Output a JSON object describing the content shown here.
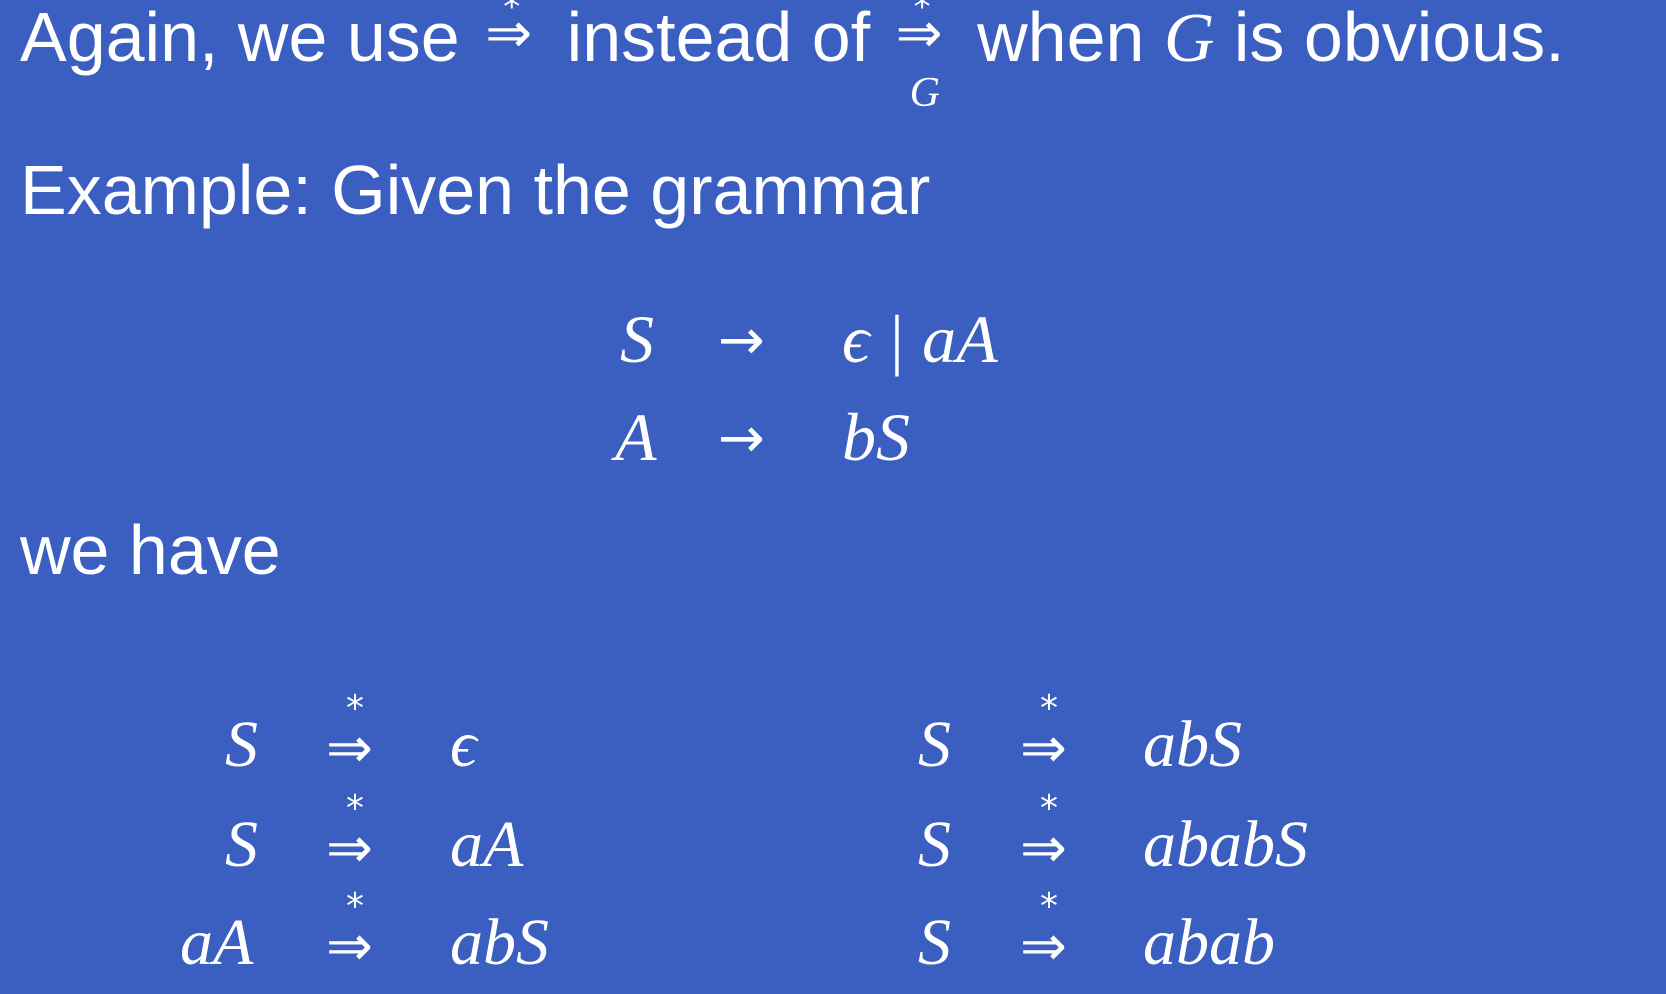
{
  "intro": {
    "part1": "Again, we use",
    "part2": "instead of",
    "part3": "when",
    "grammar_var": "G",
    "part4": "is obvious."
  },
  "symbols": {
    "derives_star": "⇒",
    "star": "*",
    "sub_G": "G",
    "arrow": "→"
  },
  "example_heading": "Example: Given the grammar",
  "grammar": [
    {
      "lhs": "S",
      "rhs": "ϵ | aA"
    },
    {
      "lhs": "A",
      "rhs": "bS"
    }
  ],
  "we_have": "we have",
  "derivations_left": [
    {
      "lhs": "S",
      "rhs": "ϵ"
    },
    {
      "lhs": "S",
      "rhs": "aA"
    },
    {
      "lhs": "aA",
      "rhs": "abS"
    }
  ],
  "derivations_right": [
    {
      "lhs": "S",
      "rhs": "abS"
    },
    {
      "lhs": "S",
      "rhs": "ababS"
    },
    {
      "lhs": "S",
      "rhs": "abab"
    }
  ],
  "colors": {
    "background": "#3a5fc1",
    "text": "#ffffff"
  }
}
